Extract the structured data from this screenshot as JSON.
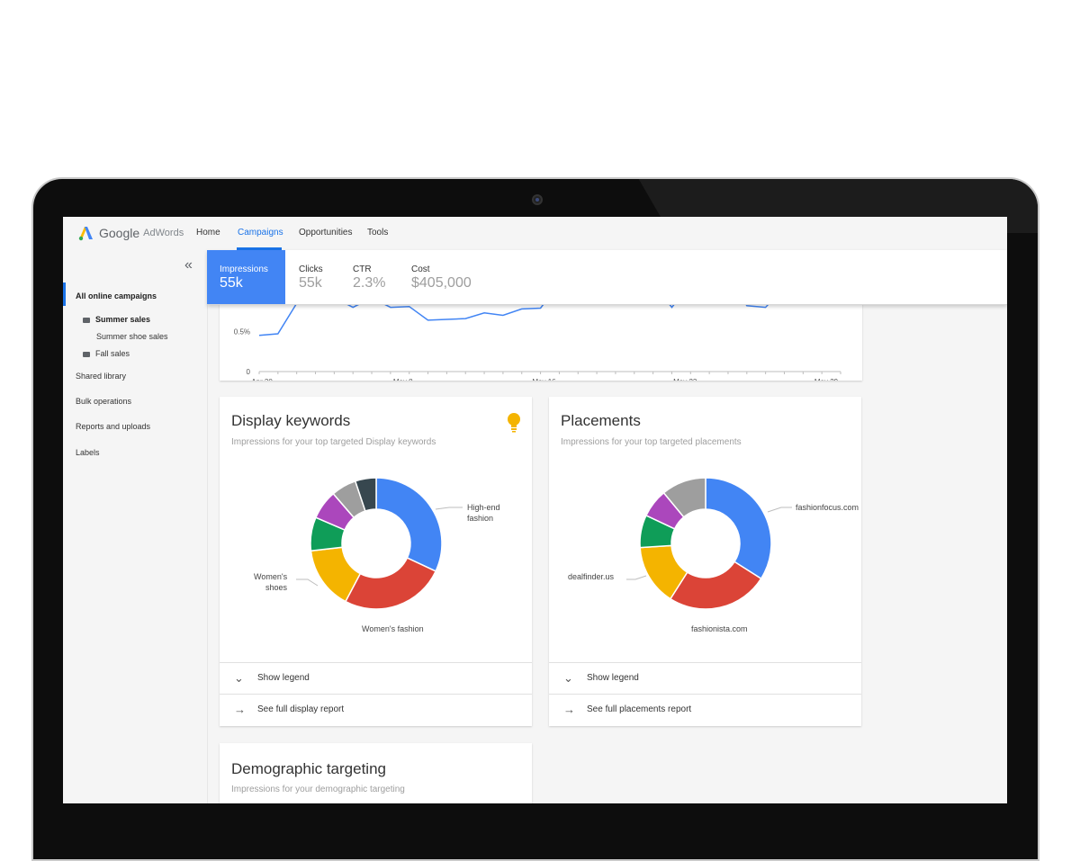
{
  "nav": {
    "logo_google": "Google",
    "logo_product": "AdWords",
    "items": [
      "Home",
      "Campaigns",
      "Opportunities",
      "Tools"
    ],
    "active": "Campaigns"
  },
  "sidebar": {
    "collapse_icon": "double-chevron-left-icon",
    "all_campaigns": "All online campaigns",
    "summer_sales": "Summer sales",
    "summer_shoe_sales": "Summer shoe sales",
    "fall_sales": "Fall sales",
    "shared_library": "Shared library",
    "bulk_operations": "Bulk operations",
    "reports_uploads": "Reports and uploads",
    "labels": "Labels"
  },
  "stats": [
    {
      "label": "Impressions",
      "value": "55k"
    },
    {
      "label": "Clicks",
      "value": "55k"
    },
    {
      "label": "CTR",
      "value": "2.3%"
    },
    {
      "label": "Cost",
      "value": "$405,000"
    }
  ],
  "chart_data": [
    {
      "type": "line",
      "x_ticks": [
        "Apr 30",
        "May 8",
        "May 16",
        "May 23",
        "May 29"
      ],
      "y_ticks": [
        "0",
        "0.5%"
      ],
      "ylim": [
        0,
        1.4
      ],
      "values": [
        0.45,
        0.47,
        0.85,
        0.87,
        0.92,
        0.8,
        0.92,
        0.8,
        0.81,
        0.64,
        0.65,
        0.66,
        0.73,
        0.7,
        0.78,
        0.79,
        1.1,
        1.3,
        1.35,
        1.3,
        1.2,
        1.1,
        0.8,
        1.1,
        1.3,
        1.25,
        0.82,
        0.8,
        1.05,
        0.99,
        0.95,
        1.1
      ],
      "color": "#4285f4"
    },
    {
      "type": "pie",
      "title": "Display keywords",
      "subtitle": "Impressions for your top targeted Display keywords",
      "slices": [
        {
          "label": "High-end fashion",
          "value": 31,
          "color": "#4285f4"
        },
        {
          "label": "Women's fashion",
          "value": 25,
          "color": "#db4437"
        },
        {
          "label": "Women's shoes",
          "value": 15,
          "color": "#f4b400"
        },
        {
          "label": "",
          "value": 8,
          "color": "#0f9d58"
        },
        {
          "label": "",
          "value": 7,
          "color": "#ab47bc"
        },
        {
          "label": "",
          "value": 6,
          "color": "#9e9e9e"
        },
        {
          "label": "",
          "value": 5,
          "color": "#37474f"
        }
      ]
    },
    {
      "type": "pie",
      "title": "Placements",
      "subtitle": "Impressions for your top targeted placements",
      "slices": [
        {
          "label": "fashionfocus.com",
          "value": 34,
          "color": "#4285f4"
        },
        {
          "label": "fashionista.com",
          "value": 25,
          "color": "#db4437"
        },
        {
          "label": "dealfinder.us",
          "value": 15,
          "color": "#f4b400"
        },
        {
          "label": "",
          "value": 8,
          "color": "#0f9d58"
        },
        {
          "label": "",
          "value": 7,
          "color": "#ab47bc"
        },
        {
          "label": "",
          "value": 11,
          "color": "#9e9e9e"
        }
      ]
    }
  ],
  "cards": {
    "keywords": {
      "title": "Display keywords",
      "subtitle": "Impressions for your top targeted Display keywords",
      "label_1a": "High-end",
      "label_1b": "fashion",
      "label_2": "Women's fashion",
      "label_3a": "Women's",
      "label_3b": "shoes",
      "show_legend": "Show legend",
      "see_full": "See full display report",
      "tip_icon": "lightbulb-icon"
    },
    "placements": {
      "title": "Placements",
      "subtitle": "Impressions for your top targeted placements",
      "label_1": "fashionfocus.com",
      "label_2": "fashionista.com",
      "label_3": "dealfinder.us",
      "show_legend": "Show legend",
      "see_full": "See full placements report"
    },
    "demographic": {
      "title": "Demographic targeting",
      "subtitle": "Impressions for your demographic targeting"
    }
  }
}
